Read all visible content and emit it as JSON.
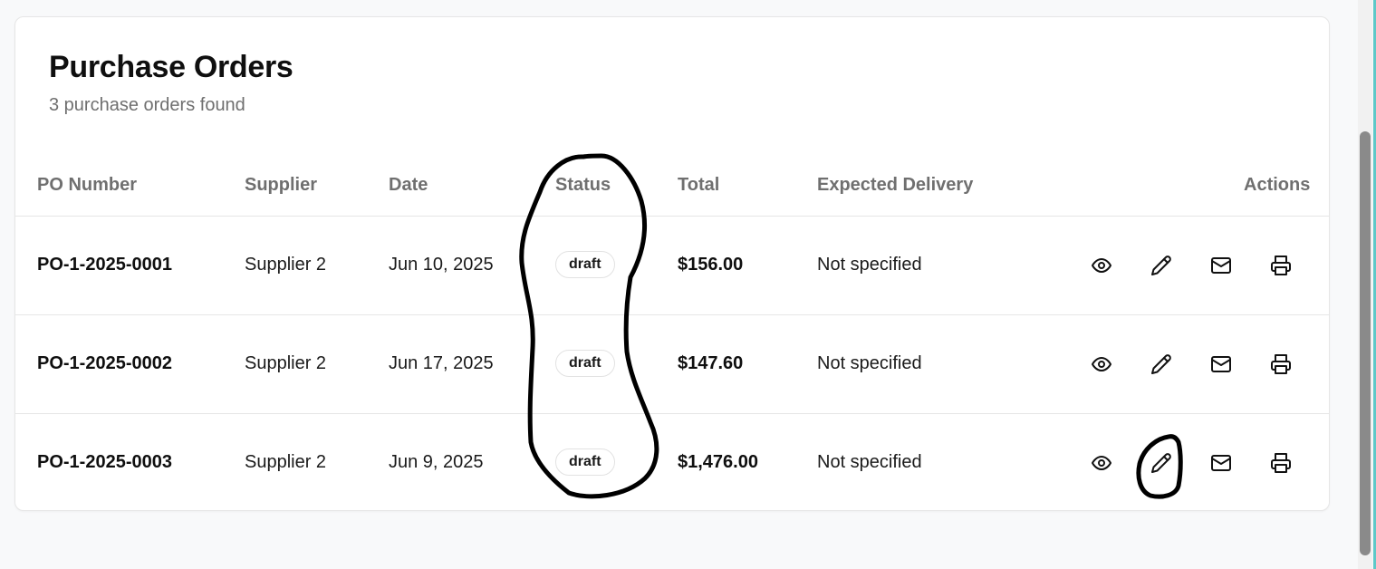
{
  "page": {
    "title": "Purchase Orders",
    "subtitle": "3 purchase orders found"
  },
  "table": {
    "headers": {
      "po_number": "PO Number",
      "supplier": "Supplier",
      "date": "Date",
      "status": "Status",
      "total": "Total",
      "expected_delivery": "Expected Delivery",
      "actions": "Actions"
    },
    "rows": [
      {
        "po_number": "PO-1-2025-0001",
        "supplier": "Supplier 2",
        "date": "Jun 10, 2025",
        "status": "draft",
        "total": "$156.00",
        "expected_delivery": "Not specified"
      },
      {
        "po_number": "PO-1-2025-0002",
        "supplier": "Supplier 2",
        "date": "Jun 17, 2025",
        "status": "draft",
        "total": "$147.60",
        "expected_delivery": "Not specified"
      },
      {
        "po_number": "PO-1-2025-0003",
        "supplier": "Supplier 2",
        "date": "Jun 9, 2025",
        "status": "draft",
        "total": "$1,476.00",
        "expected_delivery": "Not specified"
      }
    ],
    "row_actions": [
      "eye-icon",
      "pencil-icon",
      "mail-icon",
      "printer-icon"
    ]
  },
  "colors": {
    "background": "#f8f9fa",
    "card": "#ffffff",
    "border": "#e6e6e6",
    "muted_text": "#6f6f6f",
    "annotation": "#000000"
  }
}
